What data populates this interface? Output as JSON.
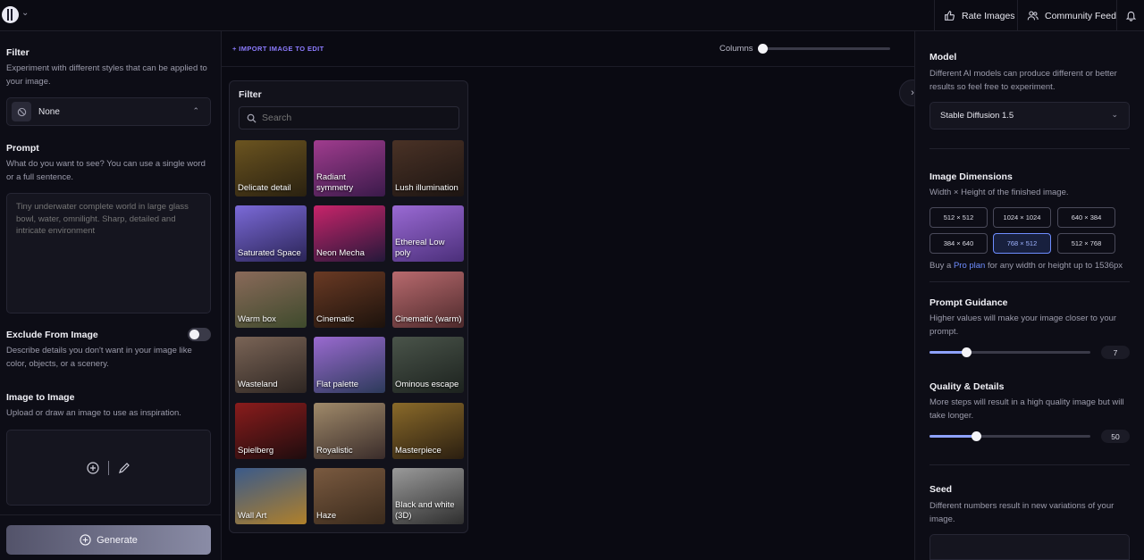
{
  "topbar": {
    "rate_images": "Rate Images",
    "community_feed": "Community Feed"
  },
  "left": {
    "filter_title": "Filter",
    "filter_desc": "Experiment with different styles that can be applied to your image.",
    "filter_value": "None",
    "prompt_title": "Prompt",
    "prompt_desc": "What do you want to see? You can use a single word or a full sentence.",
    "prompt_placeholder": "Tiny underwater complete world in large glass bowl, water, omnilight. Sharp, detailed and intricate environment",
    "exclude_title": "Exclude From Image",
    "exclude_desc": "Describe details you don't want in your image like color, objects, or a scenery.",
    "exclude_on": false,
    "img2img_title": "Image to Image",
    "img2img_desc": "Upload or draw an image to use as inspiration.",
    "generate_label": "Generate"
  },
  "center": {
    "import_label": "+ IMPORT IMAGE TO EDIT",
    "columns_label": "Columns",
    "columns_fraction": 0.0
  },
  "filter_panel": {
    "title": "Filter",
    "search_placeholder": "Search",
    "tiles": [
      {
        "label": "Delicate detail",
        "colors": [
          "#6b5420",
          "#2a2110"
        ]
      },
      {
        "label": "Radiant symmetry",
        "colors": [
          "#a03c8e",
          "#3a1a4a"
        ]
      },
      {
        "label": "Lush illumination",
        "colors": [
          "#4a3226",
          "#1d1512"
        ]
      },
      {
        "label": "Saturated Space",
        "colors": [
          "#7b6ad8",
          "#2a2456"
        ]
      },
      {
        "label": "Neon Mecha",
        "colors": [
          "#c8246a",
          "#24183a"
        ]
      },
      {
        "label": "Ethereal Low poly",
        "colors": [
          "#9a6ad4",
          "#4b2f7a"
        ]
      },
      {
        "label": "Warm box",
        "colors": [
          "#8a6a5a",
          "#3e4a2c"
        ]
      },
      {
        "label": "Cinematic",
        "colors": [
          "#6a3a24",
          "#1c120c"
        ]
      },
      {
        "label": "Cinematic (warm)",
        "colors": [
          "#b86a6e",
          "#4e2a2c"
        ]
      },
      {
        "label": "Wasteland",
        "colors": [
          "#7a6456",
          "#2e2622"
        ]
      },
      {
        "label": "Flat palette",
        "colors": [
          "#9a6ad0",
          "#2c3a5a"
        ]
      },
      {
        "label": "Ominous escape",
        "colors": [
          "#4a544a",
          "#1c221e"
        ]
      },
      {
        "label": "Spielberg",
        "colors": [
          "#8a1c1c",
          "#1e0c0e"
        ]
      },
      {
        "label": "Royalistic",
        "colors": [
          "#a08a6a",
          "#3a2c2a"
        ]
      },
      {
        "label": "Masterpiece",
        "colors": [
          "#8a6a2a",
          "#2a1e10"
        ]
      },
      {
        "label": "Wall Art",
        "colors": [
          "#3a5a8a",
          "#b0802a"
        ]
      },
      {
        "label": "Haze",
        "colors": [
          "#7a5a40",
          "#3a2a1c"
        ]
      },
      {
        "label": "Black and white (3D)",
        "colors": [
          "#9a9a9a",
          "#2e2e2e"
        ]
      }
    ]
  },
  "right": {
    "model_title": "Model",
    "model_desc": "Different AI models can produce different or better results so feel free to experiment.",
    "model_value": "Stable Diffusion 1.5",
    "dim_title": "Image Dimensions",
    "dim_desc": "Width × Height of the finished image.",
    "dims": [
      "512 × 512",
      "1024 × 1024",
      "640 × 384",
      "384 × 640",
      "768 × 512",
      "512 × 768"
    ],
    "dim_selected": "768 × 512",
    "pro_prefix": "Buy a",
    "pro_link": "Pro plan",
    "pro_suffix": "for any width or height up to 1536px",
    "guidance_title": "Prompt Guidance",
    "guidance_desc": "Higher values will make your image closer to your prompt.",
    "guidance_value": "7",
    "guidance_fraction": 0.23,
    "quality_title": "Quality & Details",
    "quality_desc": "More steps will result in a high quality image but will take longer.",
    "quality_value": "50",
    "quality_fraction": 0.29,
    "seed_title": "Seed",
    "seed_desc": "Different numbers result in new variations of your image."
  },
  "colors": {
    "accent": "#8ea2ff",
    "link": "#6e8dff",
    "import": "#8d7cff"
  }
}
